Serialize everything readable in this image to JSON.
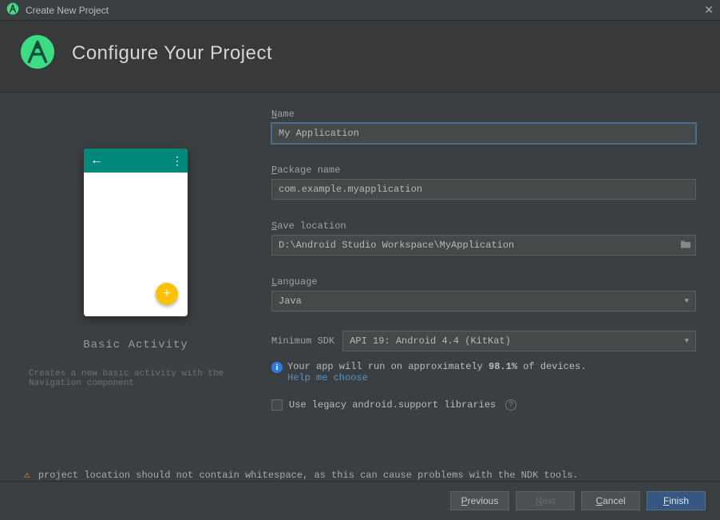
{
  "window": {
    "title": "Create New Project"
  },
  "header": {
    "title": "Configure Your Project"
  },
  "template": {
    "name": "Basic Activity",
    "description": "Creates a new basic activity with the Navigation component"
  },
  "fields": {
    "name_label": "Name",
    "name_value": "My Application",
    "package_label": "Package name",
    "package_value": "com.example.myapplication",
    "save_label": "Save location",
    "save_value": "D:\\Android Studio Workspace\\MyApplication",
    "language_label": "Language",
    "language_value": "Java",
    "sdk_label": "Minimum SDK",
    "sdk_value": "API 19: Android 4.4 (KitKat)"
  },
  "info": {
    "text_pre": "Your app will run on approximately ",
    "percent": "98.1%",
    "text_post": " of devices.",
    "help_link": "Help me choose"
  },
  "legacy": {
    "label": "Use legacy android.support libraries"
  },
  "warning": {
    "text": "project location should not contain whitespace, as this can cause problems with the NDK tools."
  },
  "buttons": {
    "previous": "Previous",
    "next": "Next",
    "cancel": "Cancel",
    "finish": "Finish"
  }
}
